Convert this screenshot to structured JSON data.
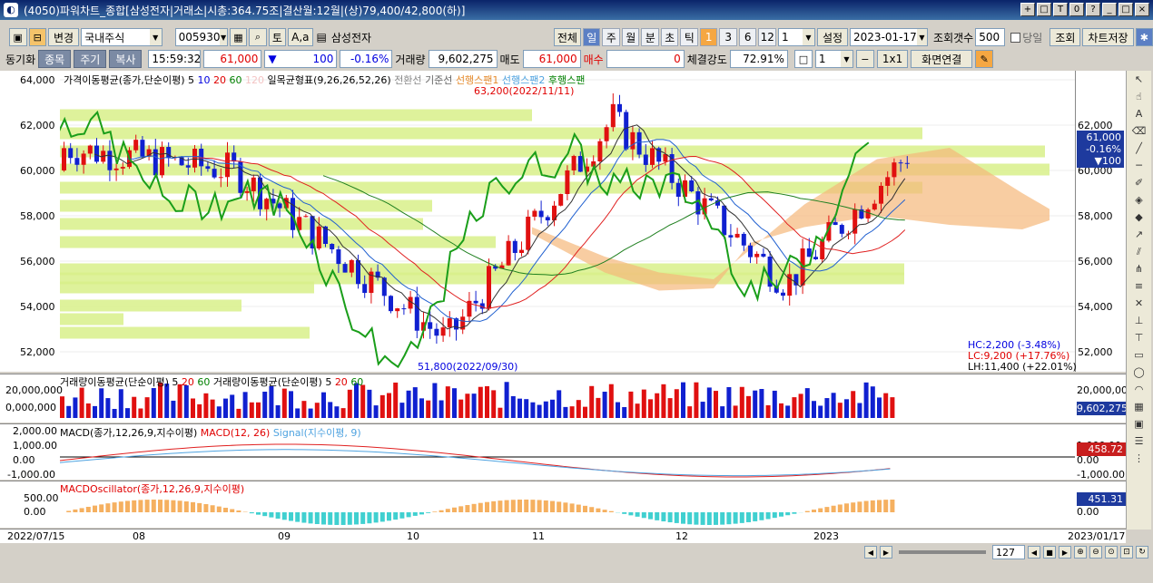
{
  "window": {
    "title": "(4050)파워차트_종합[삼성전자|거래소|시총:364.75조|결산월:12월|(상)79,400/42,800(하)]"
  },
  "toolbar": {
    "change": "변경",
    "market": "국내주식",
    "code": "005930",
    "to": "토",
    "aa": "A,a",
    "stock_name": "삼성전자",
    "period_all": "전체",
    "day": "일",
    "week": "주",
    "month": "월",
    "minute": "분",
    "tick_label": "초",
    "tick": "틱",
    "p1": "1",
    "p3": "3",
    "p6": "6",
    "p12": "12",
    "count": "1",
    "settings": "설정",
    "date": "2023-01-17",
    "query_count_label": "조회갯수",
    "query_count": "500",
    "today": "당일",
    "query": "조회",
    "save_chart": "차트저장"
  },
  "quote": {
    "sync": "동기화",
    "tab_item": "종목",
    "tab_period": "주기",
    "tab_copy": "복사",
    "time": "15:59:32",
    "price": "61,000",
    "arrow": "▼",
    "change": "100",
    "change_pct": "-0.16%",
    "vol_label": "거래량",
    "volume": "9,602,275",
    "ask_label": "매도",
    "ask": "61,000",
    "bid_label": "매수",
    "bid": "0",
    "strength_label": "체결강도",
    "strength": "72.91%",
    "count2": "1",
    "ratio": "1x1",
    "screen_link": "화면연결"
  },
  "price_panel": {
    "legend_ma": "가격이동평균(종가,단순이평)",
    "ma_5": "5",
    "ma_10": "10",
    "ma_20": "20",
    "ma_60": "60",
    "ma_120": "120",
    "legend_ichi": "일목균형표(9,26,26,52,26)",
    "conv": "전환선",
    "base": "기준선",
    "span1": "선행스팬1",
    "span2": "선행스팬2",
    "lag": "후행스팬",
    "high_note": "63,200(2022/11/11)",
    "low_note": "51,800(2022/09/30)",
    "hc": "HC:2,200 (-3.48%)",
    "lc": "LC:9,200 (+17.76%)",
    "lh": "LH:11,400 (+22.01%)",
    "cur_price": "61,000",
    "cur_pct": "-0.16%",
    "cur_chg": "▼100",
    "y_ticks": [
      "64,000",
      "62,000",
      "60,000",
      "58,000",
      "56,000",
      "54,000",
      "52,000"
    ],
    "y_ticks_right": [
      "62,000",
      "60,000",
      "58,000",
      "56,000",
      "54,000",
      "52,000"
    ]
  },
  "volume_panel": {
    "legend1": "거래량이동평균(단순이평)",
    "legend2": "거래량이동평균(단순이평)",
    "v5": "5",
    "v20": "20",
    "v60": "60",
    "y_top": "20,000,000",
    "y_zero": "0,000,000",
    "y_top_right": "20,000,000",
    "cur": "9,602,275"
  },
  "macd_panel": {
    "legend": "MACD(종가,12,26,9,지수이평)",
    "macd_label": "MACD(12, 26)",
    "signal_label": "Signal(지수이평, 9)",
    "y": [
      "2,000.00",
      "1,000.00",
      "0.00",
      "-1,000.00"
    ],
    "y_right": [
      "1,000.00",
      "0.00",
      "-1,000.00"
    ],
    "cur": "458.72"
  },
  "osc_panel": {
    "legend": "MACDOscillator(종가,12,26,9,지수이평)",
    "y": [
      "500.00",
      "0.00"
    ],
    "y_right": [
      "500.00",
      "0.00"
    ],
    "cur": "451.31"
  },
  "xaxis": {
    "start": "2022/07/15",
    "end": "2023/01/17",
    "labels": [
      "08",
      "09",
      "10",
      "11",
      "12",
      "2023"
    ]
  },
  "nav": {
    "zoom": "127"
  }
}
